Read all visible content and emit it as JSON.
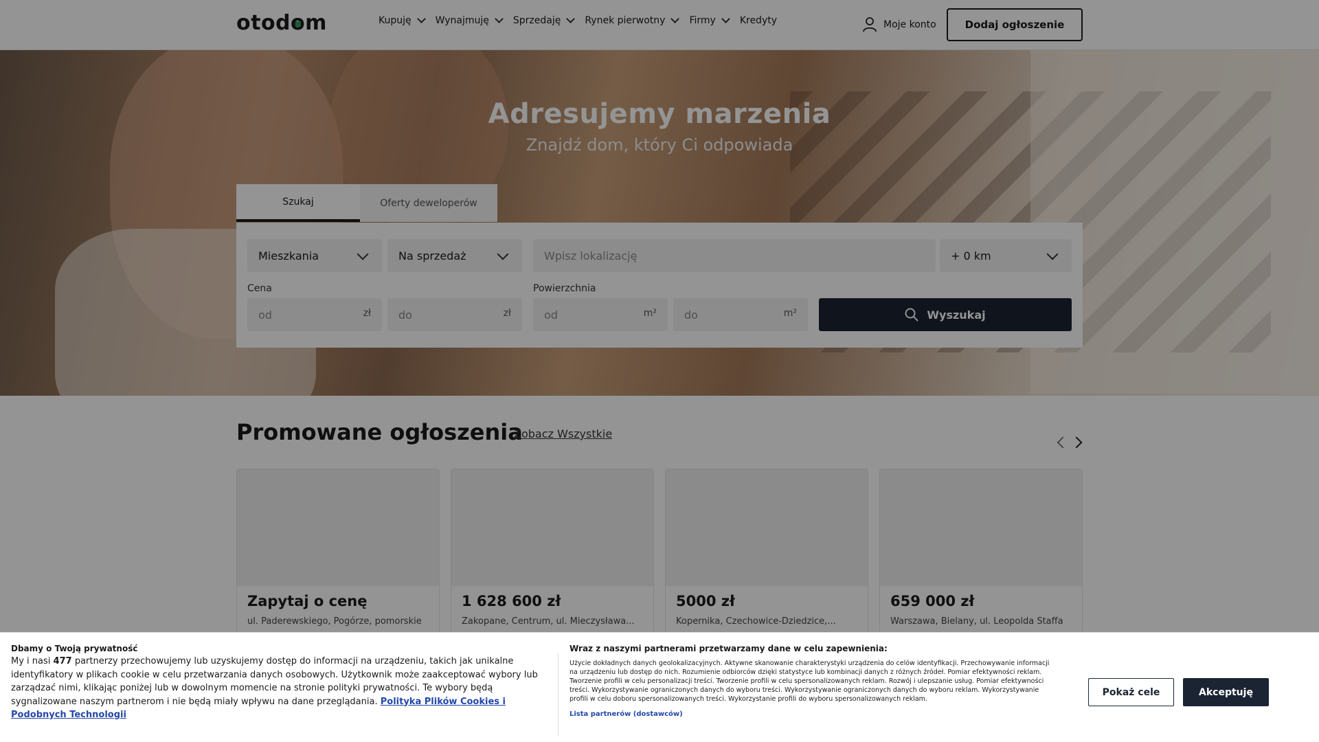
{
  "header": {
    "logo": "otodom",
    "nav": [
      {
        "label": "Kupuję",
        "dropdown": true
      },
      {
        "label": "Wynajmuję",
        "dropdown": true
      },
      {
        "label": "Sprzedaję",
        "dropdown": true
      },
      {
        "label": "Rynek pierwotny",
        "dropdown": true
      },
      {
        "label": "Firmy",
        "dropdown": true
      },
      {
        "label": "Kredyty",
        "dropdown": false
      }
    ],
    "account_label": "Moje konto",
    "add_listing_label": "Dodaj ogłoszenie"
  },
  "hero": {
    "title": "Adresujemy marzenia",
    "subtitle": "Znajdź dom, który Ci odpowiada"
  },
  "search": {
    "tabs": [
      "Szukaj",
      "Oferty deweloperów"
    ],
    "active_tab": "Szukaj",
    "property_type": "Mieszkania",
    "transaction_type": "Na sprzedaż",
    "location_placeholder": "Wpisz lokalizację",
    "radius": "+ 0 km",
    "price_label": "Cena",
    "price_from_placeholder": "od",
    "price_to_placeholder": "do",
    "price_unit": "zł",
    "area_label": "Powierzchnia",
    "area_from_placeholder": "od",
    "area_to_placeholder": "do",
    "area_unit": "m²",
    "search_button": "Wyszukaj"
  },
  "promoted": {
    "title": "Promowane ogłoszenia",
    "see_all": "Zobacz Wszystkie",
    "cards": [
      {
        "price": "Zapytaj o cenę",
        "address": "ul. Paderewskiego, Pogórze, pomorskie"
      },
      {
        "price": "1 628 600 zł",
        "address": "Zakopane, Centrum, ul. Mieczysława..."
      },
      {
        "price": "5000 zł",
        "address": "Kopernika, Czechowice-Dziedzice,..."
      },
      {
        "price": "659 000 zł",
        "address": "Warszawa, Bielany, ul. Leopolda Staffa"
      }
    ]
  },
  "cookie": {
    "heading": "Dbamy o Twoją prywatność",
    "body_pre": "My i nasi",
    "partners_count": "477",
    "body_post": "partnerzy przechowujemy lub uzyskujemy dostęp do informacji na urządzeniu, takich jak unikalne identyfikatory w plikach cookie w celu przetwarzania danych osobowych. Użytkownik może zaakceptować wybory lub zarządzać nimi, klikając poniżej lub w dowolnym momencie na stronie polityki prywatności. Te wybory będą sygnalizowane naszym partnerom i nie będą miały wpływu na dane przeglądania.",
    "policy_link": "Polityka Plików Cookies i Podobnych Technologii",
    "purposes_heading": "Wraz z naszymi partnerami przetwarzamy dane w celu zapewnienia:",
    "purposes_body": "Użycie dokładnych danych geolokalizacyjnych. Aktywne skanowanie charakterystyki urządzenia do celów identyfikacji. Przechowywanie informacji na urządzeniu lub dostęp do nich. Rozumienie odbiorców dzięki statystyce lub kombinacji danych z różnych źródeł. Pomiar efektywności reklam. Tworzenie profili w celu personalizacji treści. Tworzenie profili w celu spersonalizowanych reklam. Rozwój i ulepszanie usług. Pomiar efektywności treści. Wykorzystywanie ograniczonych danych do wyboru treści. Wykorzystywanie ograniczonych danych do wyboru reklam. Wykorzystywanie profili w celu doboru spersonalizowanych treści. Wykorzystanie profili do wyboru spersonalizowanych reklam.",
    "partners_link": "Lista partnerów (dostawców)",
    "show_purposes": "Pokaż cele",
    "accept": "Akceptuję"
  }
}
